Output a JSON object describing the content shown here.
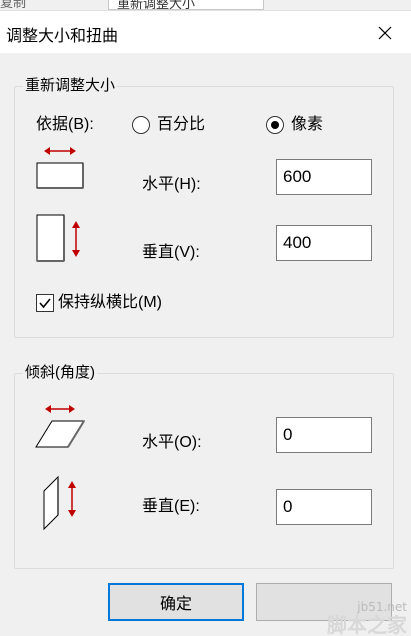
{
  "background_app": {
    "left_text": "复制",
    "tab_label": "重新调整大小"
  },
  "dialog": {
    "title": "调整大小和扭曲",
    "close_glyph": "✕"
  },
  "resize": {
    "group_label": "重新调整大小",
    "by_label": "依据(B):",
    "options": [
      "百分比",
      "像素"
    ],
    "selected_option": "像素",
    "horizontal_label": "水平(H):",
    "horizontal_value": "600",
    "vertical_label": "垂直(V):",
    "vertical_value": "400",
    "keep_ratio_label": "保持纵横比(M)",
    "keep_ratio_checked": true
  },
  "skew": {
    "group_label": "倾斜(角度)",
    "horizontal_label": "水平(O):",
    "horizontal_value": "0",
    "vertical_label": "垂直(E):",
    "vertical_value": "0"
  },
  "buttons": {
    "ok_label": "确定",
    "cancel_label": ""
  },
  "watermark": {
    "url": "jb51.net",
    "site": "脚本之家"
  },
  "colors": {
    "arrow_red": "#c00000",
    "focus_blue": "#0078d7",
    "dialog_bg": "#f0f0f0"
  }
}
